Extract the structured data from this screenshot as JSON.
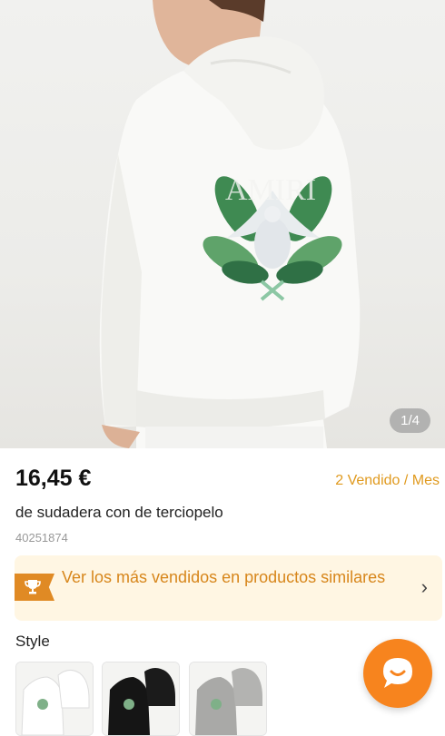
{
  "product": {
    "price": "16,45 €",
    "sold": "2 Vendido / Mes",
    "title": "de sudadera con de terciopelo",
    "sku": "40251874"
  },
  "gallery": {
    "counter": "1/4"
  },
  "banner": {
    "text": "Ver los más vendidos en productos similares",
    "icon": "trophy-icon",
    "chevron": "›"
  },
  "style": {
    "label": "Style",
    "options": [
      {
        "name": "white"
      },
      {
        "name": "black"
      },
      {
        "name": "grey"
      }
    ]
  },
  "chat": {
    "icon": "chat-bubble-icon"
  },
  "colors": {
    "accent": "#f7841e",
    "sold_text": "#e09a1f",
    "banner_bg": "#fff6e3"
  }
}
